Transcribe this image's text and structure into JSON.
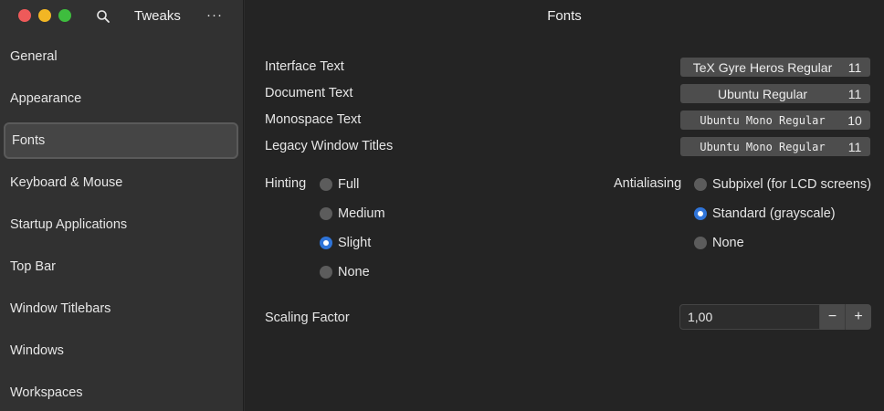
{
  "app": {
    "title": "Tweaks",
    "more": "···"
  },
  "colors": {
    "close": "#ee5a5a",
    "minimize": "#f2b624",
    "maximize": "#3ebd3e",
    "accent": "#2f74d8"
  },
  "sidebar": {
    "items": [
      {
        "label": "General"
      },
      {
        "label": "Appearance"
      },
      {
        "label": "Fonts",
        "active": true
      },
      {
        "label": "Keyboard & Mouse"
      },
      {
        "label": "Startup Applications"
      },
      {
        "label": "Top Bar"
      },
      {
        "label": "Window Titlebars"
      },
      {
        "label": "Windows"
      },
      {
        "label": "Workspaces"
      }
    ]
  },
  "main": {
    "title": "Fonts",
    "fonts": [
      {
        "label": "Interface Text",
        "font": "TeX Gyre Heros Regular",
        "size": "11"
      },
      {
        "label": "Document Text",
        "font": "Ubuntu Regular",
        "size": "11"
      },
      {
        "label": "Monospace Text",
        "font": "Ubuntu Mono Regular",
        "size": "10"
      },
      {
        "label": "Legacy Window Titles",
        "font": "Ubuntu Mono Regular",
        "size": "11"
      }
    ],
    "hinting": {
      "label": "Hinting",
      "options": [
        "Full",
        "Medium",
        "Slight",
        "None"
      ],
      "selected": "Slight"
    },
    "antialiasing": {
      "label": "Antialiasing",
      "options": [
        "Subpixel (for LCD screens)",
        "Standard (grayscale)",
        "None"
      ],
      "selected": "Standard (grayscale)"
    },
    "scaling": {
      "label": "Scaling Factor",
      "value": "1,00",
      "minus": "−",
      "plus": "+"
    }
  }
}
